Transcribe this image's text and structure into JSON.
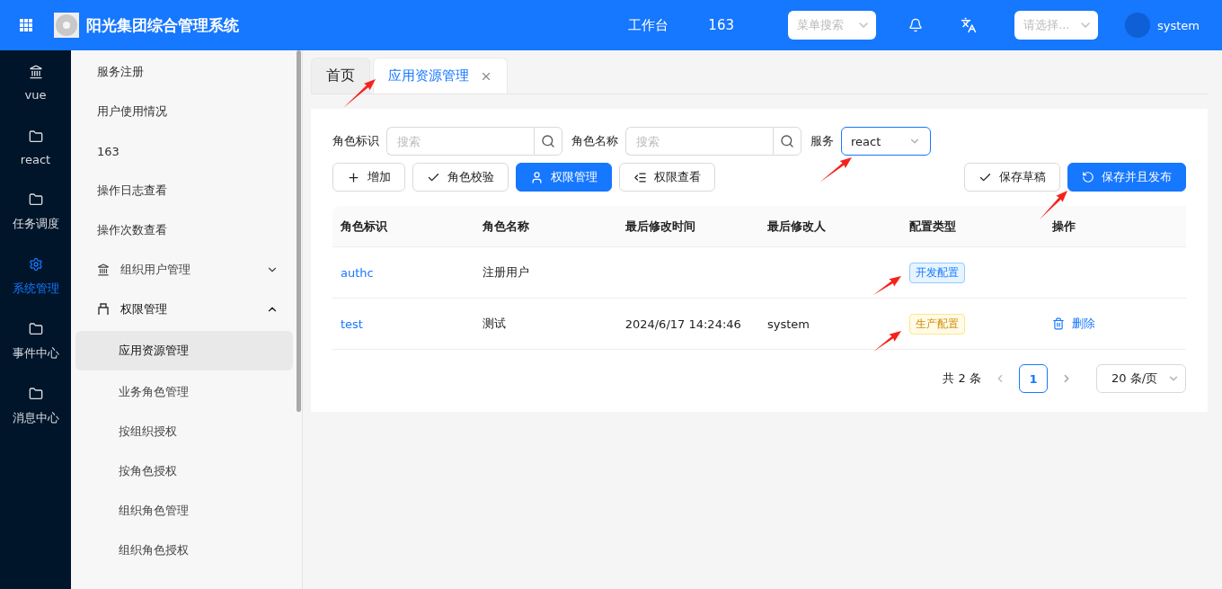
{
  "header": {
    "title": "阳光集团综合管理系统",
    "nav": [
      "工作台",
      "163"
    ],
    "menu_search": {
      "placeholder": "菜单搜索"
    },
    "select": {
      "placeholder": "请选择..."
    },
    "user": "system"
  },
  "rail": [
    {
      "label": "vue",
      "kind": "bank",
      "selected": false
    },
    {
      "label": "react",
      "kind": "folder",
      "selected": false
    },
    {
      "label": "任务调度",
      "kind": "folder",
      "selected": false
    },
    {
      "label": "系统管理",
      "kind": "gear",
      "selected": true
    },
    {
      "label": "事件中心",
      "kind": "folder",
      "selected": false
    },
    {
      "label": "消息中心",
      "kind": "folder",
      "selected": false
    }
  ],
  "submenu": [
    {
      "label": "服务注册",
      "kind": "link",
      "selected": false
    },
    {
      "label": "用户使用情况",
      "kind": "link",
      "selected": false
    },
    {
      "label": "163",
      "kind": "link",
      "selected": false
    },
    {
      "label": "操作日志查看",
      "kind": "link",
      "selected": false
    },
    {
      "label": "操作次数查看",
      "kind": "link",
      "selected": false
    },
    {
      "label": "组织用户管理",
      "kind": "group",
      "expanded": false
    },
    {
      "label": "权限管理",
      "kind": "group",
      "expanded": true,
      "children": [
        {
          "label": "应用资源管理",
          "selected": true
        },
        {
          "label": "业务角色管理",
          "selected": false
        },
        {
          "label": "按组织授权",
          "selected": false
        },
        {
          "label": "按角色授权",
          "selected": false
        },
        {
          "label": "组织角色管理",
          "selected": false
        },
        {
          "label": "组织角色授权",
          "selected": false
        }
      ]
    }
  ],
  "tabs": [
    {
      "label": "首页",
      "selected": false,
      "closable": false
    },
    {
      "label": "应用资源管理",
      "selected": true,
      "closable": true
    }
  ],
  "filters": [
    {
      "label": "角色标识",
      "placeholder": "搜索"
    },
    {
      "label": "角色名称",
      "placeholder": "搜索"
    }
  ],
  "service": {
    "label": "服务",
    "value": "react"
  },
  "buttons_left": [
    {
      "label": "增加",
      "kind": "add",
      "primary": false
    },
    {
      "label": "角色校验",
      "kind": "validate",
      "primary": false
    },
    {
      "label": "权限管理",
      "kind": "permission",
      "primary": true
    },
    {
      "label": "权限查看",
      "kind": "view",
      "primary": false
    }
  ],
  "buttons_right": [
    {
      "label": "保存草稿",
      "kind": "draft",
      "primary": false
    },
    {
      "label": "保存并且发布",
      "kind": "publish",
      "primary": true
    }
  ],
  "table": {
    "columns": [
      "角色标识",
      "角色名称",
      "最后修改时间",
      "最后修改人",
      "配置类型",
      "操作"
    ],
    "rows": [
      {
        "id": "authc",
        "name": "注册用户",
        "time": "",
        "user": "",
        "config": {
          "label": "开发配置",
          "kind": "dev"
        }
      },
      {
        "id": "test",
        "name": "测试",
        "time": "2024/6/17 14:24:46",
        "user": "system",
        "config": {
          "label": "生产配置",
          "kind": "prod"
        },
        "action": "删除"
      }
    ]
  },
  "pagination": {
    "total": "共 2 条",
    "pages": [
      {
        "label": "1",
        "selected": true
      }
    ],
    "page_size": "20 条/页"
  }
}
